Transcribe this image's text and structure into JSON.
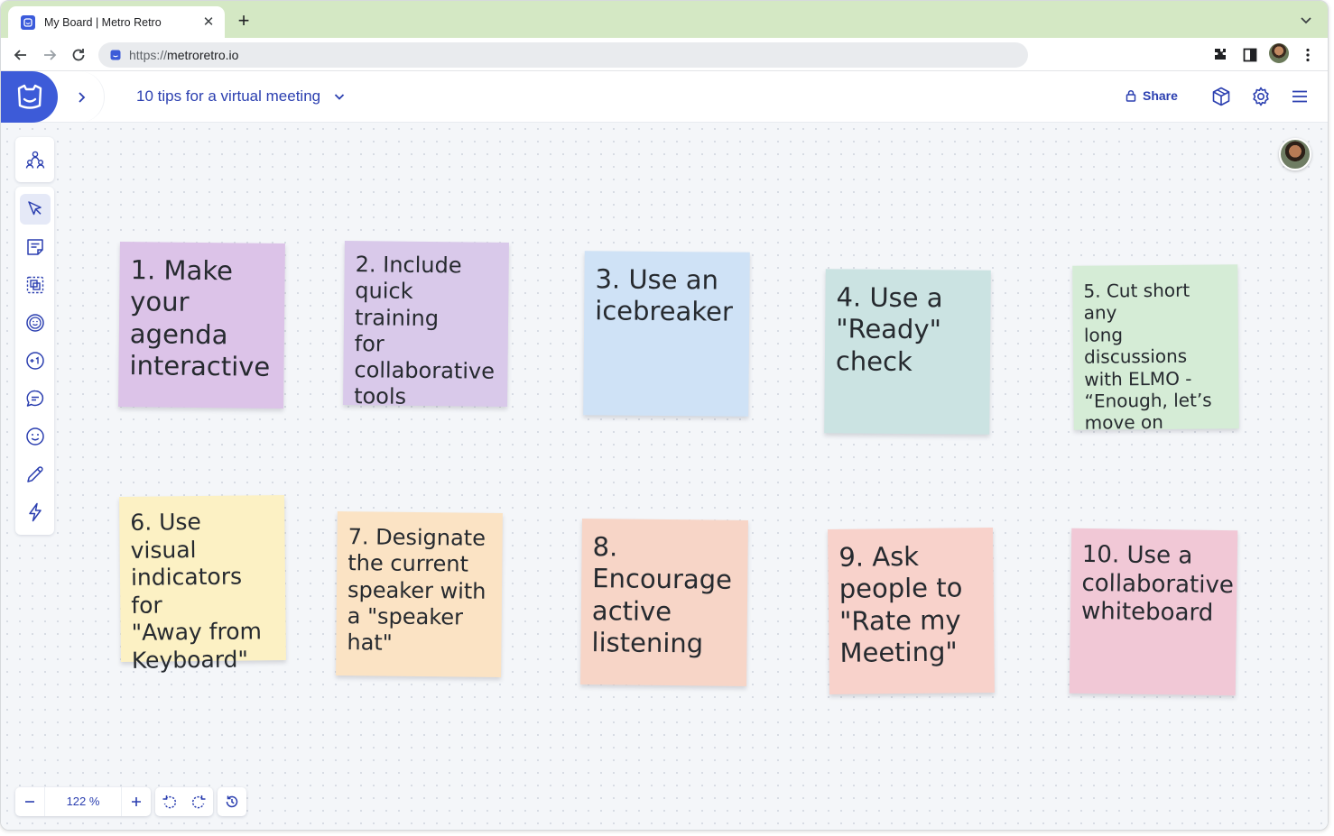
{
  "browser": {
    "tab_title": "My Board | Metro Retro",
    "url_scheme": "https://",
    "url_host": "metroretro.io"
  },
  "header": {
    "board_title": "10 tips for a virtual meeting",
    "share_label": "Share"
  },
  "notes": [
    {
      "text": "1. Make\nyour\nagenda\ninteractive",
      "color": "#dcc3e8"
    },
    {
      "text": "2. Include\nquick training\nfor\ncollaborative\ntools",
      "color": "#d9c9ea"
    },
    {
      "text": "3. Use an\nicebreaker",
      "color": "#cfe2f6"
    },
    {
      "text": "4. Use a\n\"Ready\"\ncheck",
      "color": "#cbe3e2"
    },
    {
      "text": "5. Cut short any\nlong discussions\nwith ELMO -\n“Enough, let’s\nmove on",
      "color": "#d5ecd6"
    },
    {
      "text": "6. Use visual\nindicators for\n\"Away from\nKeyboard\"",
      "color": "#fcf1c4"
    },
    {
      "text": "7. Designate\nthe current\nspeaker with\na \"speaker\nhat\"",
      "color": "#fbe3c4"
    },
    {
      "text": "8.\nEncourage\nactive\nlistening",
      "color": "#f7d5c7"
    },
    {
      "text": "9. Ask\npeople to\n\"Rate my\nMeeting\"",
      "color": "#f8d2cb"
    },
    {
      "text": "10. Use a\ncollaborative\nwhiteboard",
      "color": "#f1c8d6"
    }
  ],
  "zoom": {
    "value": "122 %"
  },
  "colors": {
    "brand": "#3d5bd8",
    "accent_text": "#2b3fb0"
  }
}
